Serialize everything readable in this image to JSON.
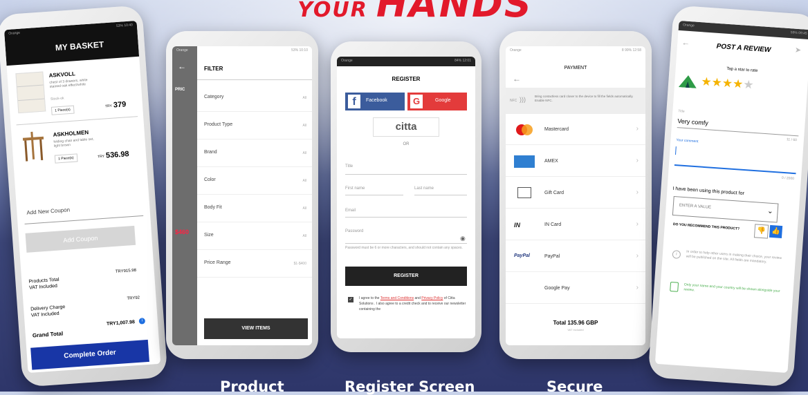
{
  "headline": {
    "small": "YOUR",
    "big": "HANDS"
  },
  "captions": [
    "Product",
    "Register Screen",
    "Secure"
  ],
  "basket": {
    "title": "MY BASKET",
    "items": [
      {
        "name": "ASKVOLL",
        "desc": "chest of 3 drawers, white stained oak effect/white",
        "stock": "Stock-ok",
        "qty": "1 Piece(s)",
        "currency": "TRY",
        "price": "379"
      },
      {
        "name": "ASKHOLMEN",
        "desc": "folding chair and table set, light brown",
        "qty": "1 Piece(s)",
        "currency": "TRY",
        "price": "536.98"
      }
    ],
    "coupon_placeholder": "Add New Coupon",
    "coupon_button": "Add Coupon",
    "products_total_label": "Products Total\nVAT Included",
    "products_total_value": "TRY915.98",
    "delivery_label": "Delivery Charge\nVAT Included",
    "delivery_value": "TRY92",
    "grand_total_label": "Grand Total",
    "grand_total_value": "TRY1,007.98",
    "complete_button": "Complete Order"
  },
  "filter": {
    "title": "FILTER",
    "rows": [
      {
        "label": "Category",
        "value": "All"
      },
      {
        "label": "Product Type",
        "value": "All"
      },
      {
        "label": "Brand",
        "value": "All"
      },
      {
        "label": "Color",
        "value": "All"
      },
      {
        "label": "Body Fit",
        "value": "All"
      },
      {
        "label": "Size",
        "value": "All"
      },
      {
        "label": "Price Range",
        "value": "$1-$400"
      }
    ],
    "button": "VIEW ITEMS",
    "bg_text": [
      "PRIC",
      "$460",
      "$46"
    ]
  },
  "register": {
    "title": "REGISTER",
    "facebook": "Facebook",
    "google": "Google",
    "logo": "citta",
    "or": "OR",
    "title_ph": "Title",
    "first_ph": "First name",
    "last_ph": "Last name",
    "email_ph": "Email",
    "password_ph": "Password",
    "password_hint": "Password must be 6 or more characters, and should not contain any spaces.",
    "button": "REGISTER",
    "terms_1": "I agree to the ",
    "terms_link1": "Terms and Conditions",
    "terms_2": " and ",
    "terms_link2": "Privacy Policy",
    "terms_3": " of Citta Solutions . I also agree to a credit check and to receive our newsletter containing the"
  },
  "payment": {
    "title": "PAYMENT",
    "nfc_label": "NFC",
    "nfc_text": "Bring contactless card closer to the device to fill the fields automatically. Enable NFC.",
    "methods": [
      {
        "icon": "mastercard-icon",
        "label": "Mastercard"
      },
      {
        "icon": "amex-icon",
        "label": "AMEX"
      },
      {
        "icon": "gift-card-icon",
        "label": "Gift Card"
      },
      {
        "icon": "in-card-icon",
        "label": "IN Card",
        "mark": "IN"
      },
      {
        "icon": "paypal-icon",
        "label": "PayPal",
        "mark": "PayPal"
      },
      {
        "icon": "google-pay-icon",
        "label": "Google Pay"
      }
    ],
    "total": "Total 135.96 GBP",
    "total_sub": "VAT Included"
  },
  "review": {
    "title": "POST A REVIEW",
    "tap_text": "Tap a star to rate",
    "rating": 4,
    "title_label": "Title",
    "title_value": "Very comfy",
    "title_count": "11 / 60",
    "comment_label": "Your comment",
    "comment_count": "0 / 2000",
    "duration_label": "I have been using this product for",
    "duration_ph": "ENTER A VALUE",
    "recommend": "DO YOU RECOMMEND THIS PRODUCT?",
    "info": "In order to help other users in making their choice, your review will be published on the site. All fields are mandatory.",
    "privacy": "Only your name and your country will be shown alongside your review."
  }
}
